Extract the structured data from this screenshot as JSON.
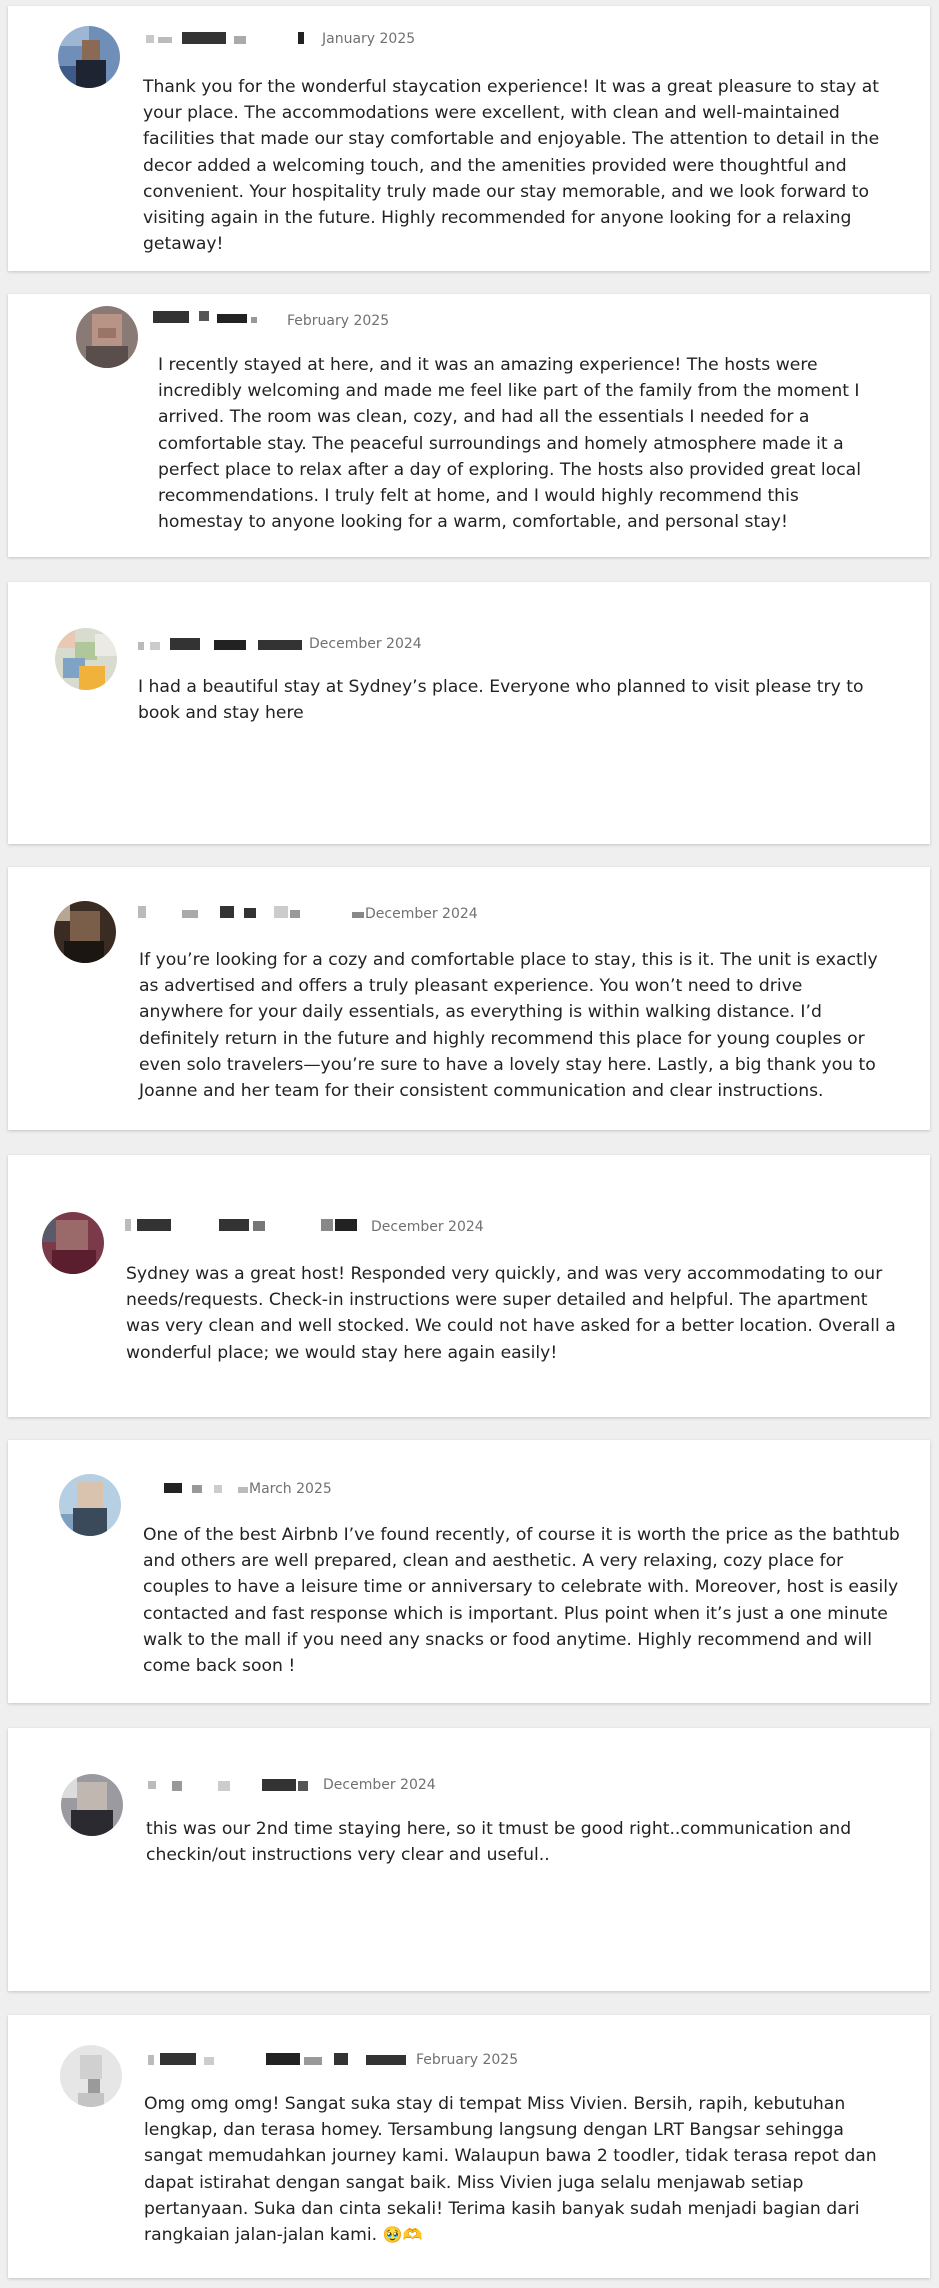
{
  "reviews": [
    {
      "date": "January 2025",
      "text": "Thank you for the wonderful staycation experience! It was a great pleasure to stay at your place. The accommodations were excellent, with clean and well-maintained facilities that made our stay comfortable and enjoyable. The attention to detail in the decor added a welcoming touch, and the amenities provided were thoughtful and convenient. Your hospitality truly made our stay memorable, and we look forward to visiting again in the future. Highly recommended for anyone looking for a relaxing getaway!"
    },
    {
      "date": "February 2025",
      "text": "I recently stayed at here, and it was an amazing experience! The hosts were incredibly welcoming and made me feel like part of the family from the moment I arrived. The room was clean, cozy, and had all the essentials I needed for a comfortable stay. The peaceful surroundings and homely atmosphere made it a perfect place to relax after a day of exploring. The hosts also provided great local recommendations. I truly felt at home, and I would highly recommend this homestay to anyone looking for a warm, comfortable, and personal stay!"
    },
    {
      "date": "December 2024",
      "text": "I had a beautiful stay at Sydney’s place. Everyone who planned to visit please try to book and stay here"
    },
    {
      "date": "December 2024",
      "text": "If you’re looking for a cozy and comfortable place to stay, this is it. The unit is exactly as advertised and offers a truly pleasant experience. You won’t need to drive anywhere for your daily essentials, as everything is within walking distance. I’d definitely return in the future and highly recommend this place for young couples or even solo travelers—you’re sure to have a lovely stay here. Lastly, a big thank you to Joanne and her team for their consistent communication and clear instructions."
    },
    {
      "date": "December 2024",
      "text": "Sydney was a great host! Responded very quickly, and was very accommodating to our needs/requests. Check-in instructions were super detailed and helpful. The apartment was very clean and well stocked. We could not have asked for a better location. Overall a wonderful place; we would stay here again easily!"
    },
    {
      "date": "March 2025",
      "text": "One of the best Airbnb I’ve found recently, of course it is worth the price as the bathtub and others are well prepared, clean and aesthetic. A very relaxing, cozy place for couples to have a leisure time or anniversary to celebrate with. Moreover, host is easily contacted and fast response which is important. Plus point when it’s just a one minute walk to the mall if you need any snacks or food anytime. Highly recommend and will come back soon !"
    },
    {
      "date": "December 2024",
      "text": "this was our 2nd time staying here, so it tmust be good right..communication and checkin/out instructions very clear and useful.."
    },
    {
      "date": "February 2025",
      "text": "Omg omg omg! Sangat suka stay di tempat Miss Vivien. Bersih, rapih, kebutuhan lengkap, dan terasa homey. Tersambung langsung dengan LRT Bangsar sehingga sangat memudahkan journey kami. Walaupun bawa 2 toodler, tidak terasa repot dan dapat istirahat dengan sangat baik. Miss Vivien juga selalu menjawab setiap pertanyaan. Suka dan cinta sekali! Terima kasih banyak sudah menjadi bagian dari rangkaian jalan-jalan kami.",
      "emoji": "🥹🫶"
    }
  ]
}
